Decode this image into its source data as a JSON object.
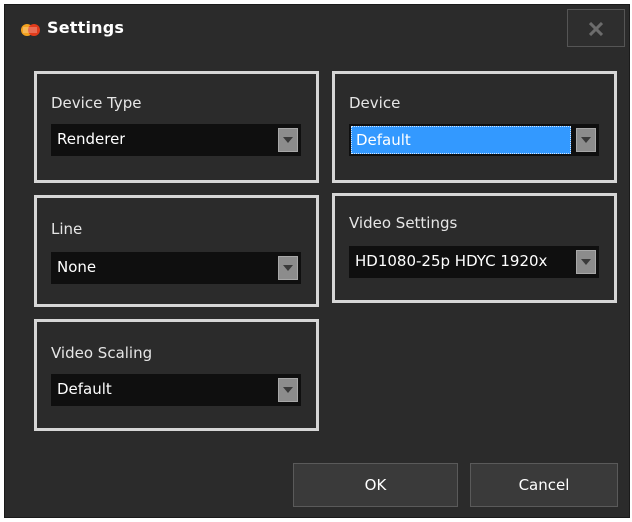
{
  "window": {
    "title": "Settings",
    "app_logo_icon": "jsp-logo-icon",
    "close_icon": "close-icon"
  },
  "panels": {
    "device_type": {
      "label": "Device Type",
      "value": "Renderer"
    },
    "device": {
      "label": "Device",
      "value": "Default",
      "selected": true
    },
    "line": {
      "label": "Line",
      "value": "None"
    },
    "video_settings": {
      "label": "Video Settings",
      "value": "HD1080-25p HDYC 1920x"
    },
    "video_scaling": {
      "label": "Video Scaling",
      "value": "Default"
    }
  },
  "buttons": {
    "ok": "OK",
    "cancel": "Cancel"
  },
  "colors": {
    "window_bg": "#2b2b2b",
    "panel_border": "#d6d6d6",
    "select_bg": "#0f0f0f",
    "selection_highlight": "#3399ff"
  }
}
